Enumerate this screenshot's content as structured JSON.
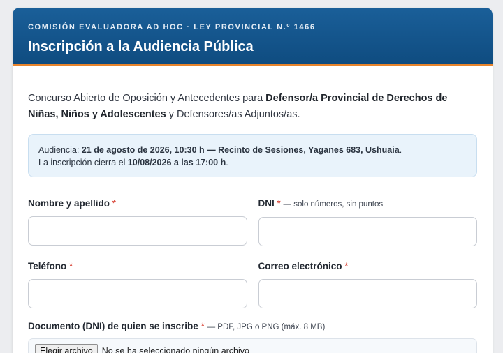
{
  "header": {
    "kicker": "COMISIÓN EVALUADORA AD HOC · LEY PROVINCIAL N.º 1466",
    "title": "Inscripción a la Audiencia Pública"
  },
  "intro": {
    "text_1": "Concurso Abierto de Oposición y Antecedentes para ",
    "bold": "Defensor/a Provincial de Derechos de Niñas, Niños y Adolescentes",
    "text_2": " y Defensores/as Adjuntos/as."
  },
  "notice": {
    "line1_prefix": "Audiencia: ",
    "line1_bold": "21 de agosto de 2026, 10:30 h — Recinto de Sesiones, Yaganes 683, Ushuaia",
    "line1_suffix": ".",
    "line2_prefix": "La inscripción cierra el ",
    "line2_bold": "10/08/2026 a las 17:00 h",
    "line2_suffix": "."
  },
  "form": {
    "required_mark": "*",
    "name": {
      "label": "Nombre y apellido",
      "value": ""
    },
    "dni": {
      "label": "DNI",
      "hint": "— solo números, sin puntos",
      "value": ""
    },
    "phone": {
      "label": "Teléfono",
      "value": ""
    },
    "email": {
      "label": "Correo electrónico",
      "value": ""
    },
    "document": {
      "label": "Documento (DNI) de quien se inscribe",
      "hint": "— PDF, JPG o PNG (máx. 8 MB)",
      "button_label": "Elegir archivo",
      "status": "No se ha seleccionado ningún archivo"
    }
  },
  "colors": {
    "header_bg": "#0f4c80",
    "accent": "#e8842c",
    "required": "#d6392b",
    "notice_bg": "#e9f3fb"
  }
}
